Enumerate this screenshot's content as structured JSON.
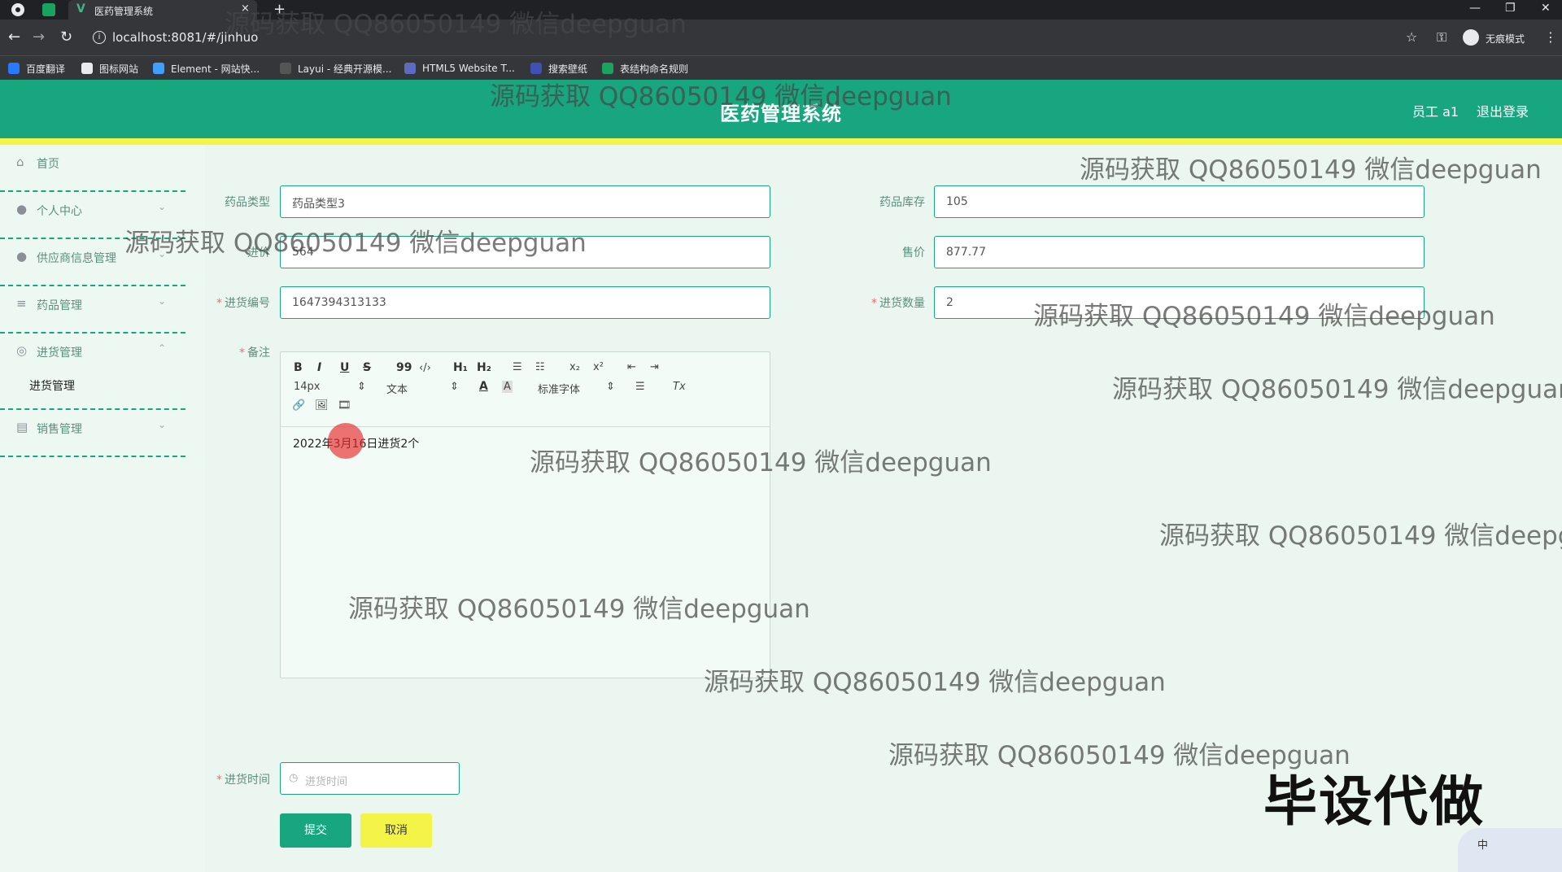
{
  "browser": {
    "tab_title": "医药管理系统",
    "tab_close": "×",
    "new_tab": "+",
    "url": "localhost:8081/#/jinhuo",
    "incognito_label": "无痕模式",
    "bookmarks": [
      {
        "label": "百度翻译",
        "color": "#2979ff"
      },
      {
        "label": "图标网站",
        "color": "#e8eaed"
      },
      {
        "label": "Element - 网站快...",
        "color": "#409eff"
      },
      {
        "label": "Layui - 经典开源模...",
        "color": "#555555"
      },
      {
        "label": "HTML5 Website T...",
        "color": "#5c6bc0"
      },
      {
        "label": "搜索壁纸",
        "color": "#3f51b5"
      },
      {
        "label": "表结构命名规则",
        "color": "#1aa260"
      }
    ]
  },
  "header": {
    "title": "医药管理系统",
    "user": "员工 a1",
    "logout": "退出登录"
  },
  "colors": {
    "primary": "#17a67d",
    "accent_yellow": "#f4f347",
    "required": "#f56c6c"
  },
  "sidebar": {
    "items": [
      {
        "label": "首页",
        "icon": "home-icon"
      },
      {
        "label": "个人中心",
        "icon": "user-icon"
      },
      {
        "label": "供应商信息管理",
        "icon": "user-icon"
      },
      {
        "label": "药品管理",
        "icon": "list-icon"
      },
      {
        "label": "进货管理",
        "icon": "compass-icon"
      },
      {
        "label": "销售管理",
        "icon": "briefcase-icon"
      }
    ],
    "submenu": {
      "label": "进货管理"
    }
  },
  "form": {
    "drug_type": {
      "label": "药品类型",
      "value": "药品类型3"
    },
    "stock": {
      "label": "药品库存",
      "value": "105"
    },
    "purchase_price": {
      "label": "进价",
      "value": "564"
    },
    "sale_price": {
      "label": "售价",
      "value": "877.77"
    },
    "purchase_no": {
      "label": "进货编号",
      "value": "1647394313133"
    },
    "quantity": {
      "label": "进货数量",
      "value": "2"
    },
    "remark": {
      "label": "备注",
      "content": "2022年3月16日进货2个",
      "toolbar": {
        "bold": "B",
        "italic": "I",
        "underline": "U",
        "strike": "S",
        "quote": "99",
        "code": "‹/›",
        "h1": "H₁",
        "h2": "H₂",
        "ordered_list": "☰",
        "bullet_list": "☷",
        "subscript": "x₂",
        "superscript": "x²",
        "outdent": "⇤",
        "indent": "⇥",
        "size": "14px",
        "text": "文本",
        "color": "A",
        "background": "A",
        "font": "标准字体",
        "align": "☰",
        "clear": "Tx",
        "link": "🔗",
        "image": "🖼",
        "video": "🎞"
      }
    },
    "purchase_time": {
      "label": "进货时间",
      "placeholder": "进货时间"
    },
    "submit": "提交",
    "cancel": "取消"
  },
  "overlays": {
    "watermark": "源码获取 QQ86050149 微信deepguan",
    "stamp": "毕设代做",
    "ime": "中"
  }
}
